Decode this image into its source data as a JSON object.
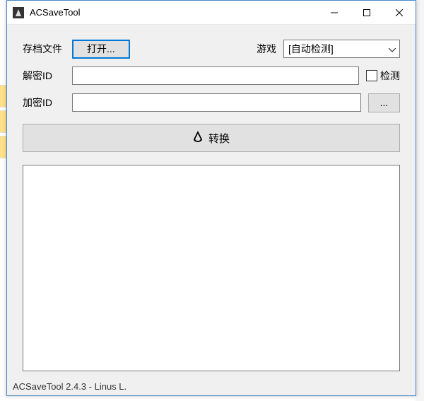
{
  "window": {
    "title": "ACSaveTool"
  },
  "labels": {
    "save_file": "存档文件",
    "game": "游戏",
    "decrypt_id": "解密ID",
    "encrypt_id": "加密ID",
    "detect": "检测"
  },
  "buttons": {
    "open": "打开...",
    "browse": "...",
    "convert": "转换"
  },
  "game_select": {
    "value": "[自动检测]"
  },
  "inputs": {
    "decrypt_id_value": "",
    "encrypt_id_value": ""
  },
  "log": "",
  "status": "ACSaveTool 2.4.3 - Linus L."
}
